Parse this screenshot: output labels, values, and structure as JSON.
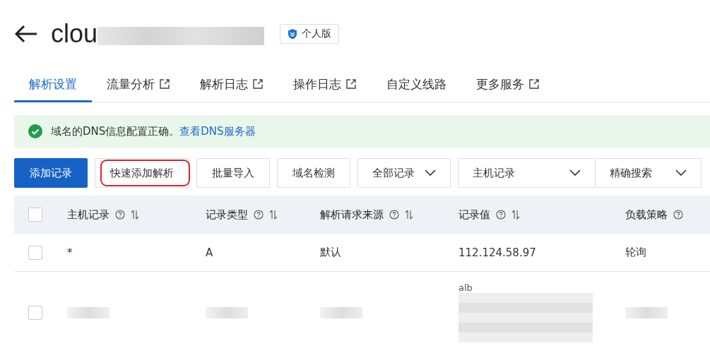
{
  "header": {
    "title": "clou",
    "badge": "个人版"
  },
  "tabs": [
    {
      "label": "解析设置",
      "selected": true,
      "external": false
    },
    {
      "label": "流量分析",
      "selected": false,
      "external": true
    },
    {
      "label": "解析日志",
      "selected": false,
      "external": true
    },
    {
      "label": "操作日志",
      "selected": false,
      "external": true
    },
    {
      "label": "自定义线路",
      "selected": false,
      "external": false
    },
    {
      "label": "更多服务",
      "selected": false,
      "external": true
    }
  ],
  "alert": {
    "message": "域名的DNS信息配置正确。",
    "link": "查看DNS服务器"
  },
  "toolbar": {
    "buttons": [
      {
        "label": "添加记录",
        "kind": "primary",
        "highlighted": false
      },
      {
        "label": "快速添加解析",
        "kind": "default",
        "highlighted": true
      },
      {
        "label": "批量导入",
        "kind": "default",
        "highlighted": false
      },
      {
        "label": "域名检测",
        "kind": "default",
        "highlighted": false
      }
    ],
    "filter": "全部记录",
    "search_field": "主机记录",
    "search_mode": "精确搜索"
  },
  "table": {
    "select_all_checked": false,
    "columns": [
      {
        "label": "主机记录",
        "sortable": true
      },
      {
        "label": "记录类型",
        "sortable": true
      },
      {
        "label": "解析请求来源",
        "sortable": true
      },
      {
        "label": "记录值",
        "sortable": true
      },
      {
        "label": "负载策略",
        "sortable": false
      }
    ],
    "rows": [
      {
        "checked": false,
        "cells": [
          "*",
          "A",
          "默认",
          "112.124.58.97",
          "轮询"
        ]
      },
      {
        "checked": false,
        "blurred": true,
        "cells": [
          "",
          "",
          "",
          "alb",
          ""
        ]
      }
    ]
  }
}
